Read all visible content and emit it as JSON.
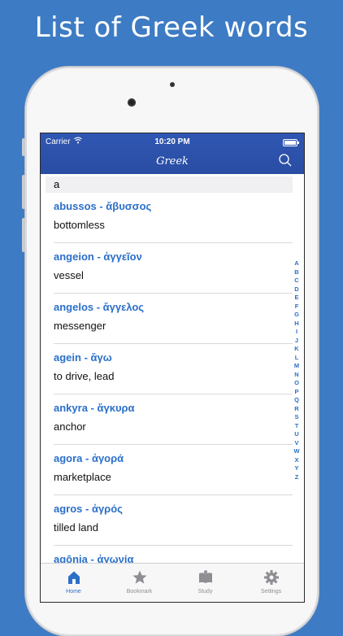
{
  "promo": {
    "title": "List of Greek words"
  },
  "status_bar": {
    "carrier": "Carrier",
    "time": "10:20 PM",
    "battery_level": 1.0
  },
  "nav": {
    "title": "Greek",
    "search_icon": "search-icon"
  },
  "section": {
    "header": "a"
  },
  "entries": [
    {
      "term": "abussos - ἄβυσσος",
      "meaning": "bottomless"
    },
    {
      "term": "angeion - ἀγγεῖον",
      "meaning": "vessel"
    },
    {
      "term": "angelos - ἄγγελος",
      "meaning": "messenger"
    },
    {
      "term": "agein - ἄγω",
      "meaning": "to drive, lead"
    },
    {
      "term": "ankyra - ἄγκυρα",
      "meaning": "anchor"
    },
    {
      "term": "agora - ἀγορά",
      "meaning": "marketplace"
    },
    {
      "term": "agros - ἀγρός",
      "meaning": "tilled land"
    },
    {
      "term": "agōnia - ἀγωνία",
      "meaning": ""
    }
  ],
  "alphabet_index": [
    "A",
    "B",
    "C",
    "D",
    "E",
    "F",
    "G",
    "H",
    "I",
    "J",
    "K",
    "L",
    "M",
    "N",
    "O",
    "P",
    "Q",
    "R",
    "S",
    "T",
    "U",
    "V",
    "W",
    "X",
    "Y",
    "Z"
  ],
  "tabs": [
    {
      "label": "Home",
      "icon": "home-icon",
      "active": true
    },
    {
      "label": "Bookmark",
      "icon": "star-icon",
      "active": false
    },
    {
      "label": "Study",
      "icon": "book-icon",
      "active": false
    },
    {
      "label": "Settings",
      "icon": "gear-icon",
      "active": false
    }
  ],
  "colors": {
    "background": "#3d7cc4",
    "nav_bar": "#2f57b3",
    "accent": "#2b6fc9",
    "inactive_tab": "#8e8e93"
  }
}
